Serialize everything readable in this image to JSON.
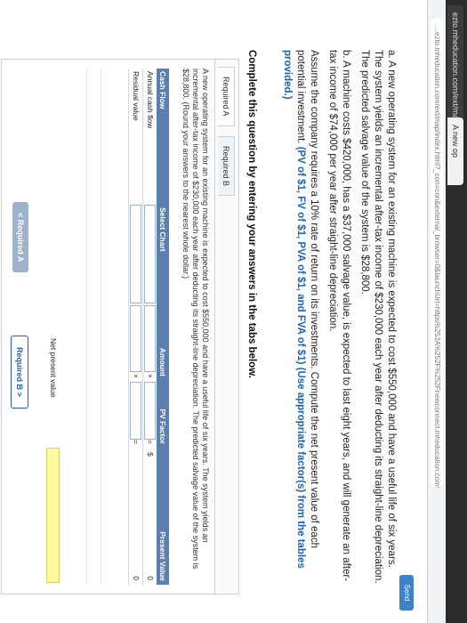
{
  "browser": {
    "tab_1": "ezto.mheducation.com/ext/map/index.html",
    "tab_2": "A new op",
    "url": "…ezto.mheducation.com/ext/map/index.html?_con=con&external_browser=0&launchUrl=https%253A%252F%252Fnewconnect.mheducation.com%252Fflow%252Fconnect.html"
  },
  "toolbar": {
    "send_label": "Send"
  },
  "question": {
    "a_text": "a. A new operating system for an existing machine is expected to cost $550,000 and have a useful life of six years. The system yields an incremental after-tax income of $230,000 each year after deducting its straight-line depreciation. The predicted salvage value of the system is $28,800.",
    "b_text": "b. A machine costs $420,000, has a $37,000 salvage value, is expected to last eight years, and will generate an after-tax income of $74,000 per year after straight-line depreciation.",
    "assume_text": "Assume the company requires a 10% rate of return on its investments. Compute the net present value of each potential investment.",
    "links_text": "(PV of $1, FV of $1, PVA of $1, and FVA of $1) (Use appropriate factor(s) from the tables provided.)"
  },
  "instruction": "Complete this question by entering your answers in the tabs below.",
  "tabs": {
    "required_a": "Required A",
    "required_b": "Required B"
  },
  "prompt": "A new operating system for an existing machine is expected to cost $550,000 and have a useful life of six years. The system yields an incremental after-tax income of $230,000 each year after deducting its straight-line depreciation. The predicted salvage value of the system is $28,800. (Round your answers to the nearest whole dollar.)",
  "grid": {
    "headers": {
      "cash_flow": "Cash Flow",
      "select_chart": "Select Chart",
      "amount": "Amount",
      "pv_factor": "PV Factor",
      "present_value": "Present Value"
    },
    "rows": [
      {
        "label": "Annual cash flow",
        "op": "×",
        "eq": "=",
        "currency": "$",
        "present_value": "0"
      },
      {
        "label": "Residual value",
        "op": "×",
        "eq": "=",
        "currency": "",
        "present_value": "0"
      }
    ],
    "npv_label": "Net present value"
  },
  "nav": {
    "prev_label": "< Required A",
    "next_label": "Required B >"
  },
  "colors": {
    "header_blue": "#5a7fb0",
    "link_blue": "#1e63b8",
    "highlight_yellow": "#fffaa0"
  }
}
